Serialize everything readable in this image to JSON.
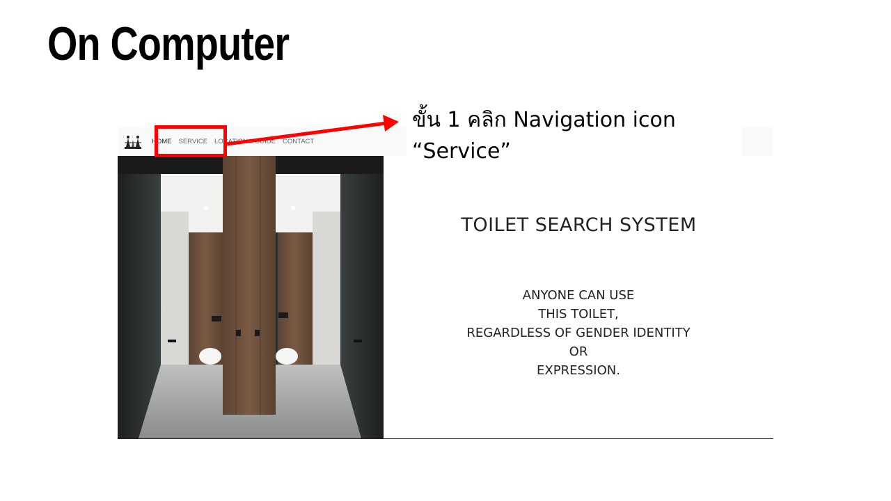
{
  "slide": {
    "title": "On Computer"
  },
  "annotation": {
    "line1": "ขั้น 1 คลิก Navigation icon",
    "line2": "“Service”",
    "highlight_color": "#ff0000"
  },
  "website": {
    "nav": {
      "items": [
        {
          "label": "HOME"
        },
        {
          "label": "SERVICE"
        },
        {
          "label": "LOCATION"
        },
        {
          "label": "GUIDE"
        },
        {
          "label": "CONTACT"
        }
      ]
    },
    "carousel": {
      "prev_icon": "chevron-left"
    },
    "headline": "TOILET SEARCH SYSTEM",
    "tagline": {
      "lines": [
        "ANYONE CAN USE",
        "THIS TOILET,",
        "REGARDLESS OF GENDER IDENTITY",
        "OR",
        "EXPRESSION."
      ]
    }
  }
}
